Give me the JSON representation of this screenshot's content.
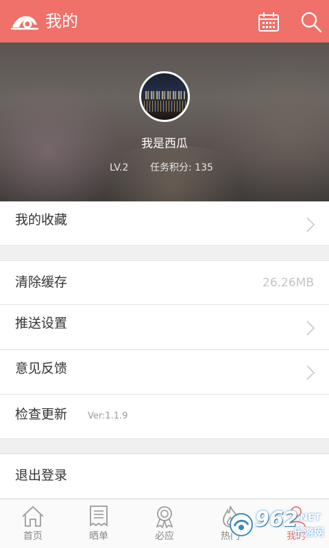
{
  "header": {
    "title": "我的"
  },
  "profile": {
    "username": "我是西瓜",
    "level": "LV.2",
    "points": "任务积分: 135"
  },
  "menu": {
    "favorites": "我的收藏",
    "clear_cache": "清除缓存",
    "cache_size": "26.26MB",
    "push_settings": "推送设置",
    "feedback": "意见反馈",
    "check_update": "检查更新",
    "version": "Ver:1.1.9",
    "logout": "退出登录"
  },
  "tabs": [
    {
      "label": "首页",
      "icon": "home-icon"
    },
    {
      "label": "晒单",
      "icon": "receipt-icon"
    },
    {
      "label": "必应",
      "icon": "badge-icon"
    },
    {
      "label": "热门",
      "icon": "flame-icon"
    },
    {
      "label": "我的",
      "icon": "user-icon"
    }
  ],
  "watermark": {
    "number": "962",
    "net": ".NET",
    "text": "乐游网"
  },
  "colors": {
    "accent": "#f0706a",
    "text": "#333333",
    "muted": "#c4c4c4",
    "background": "#f0f0f0"
  }
}
